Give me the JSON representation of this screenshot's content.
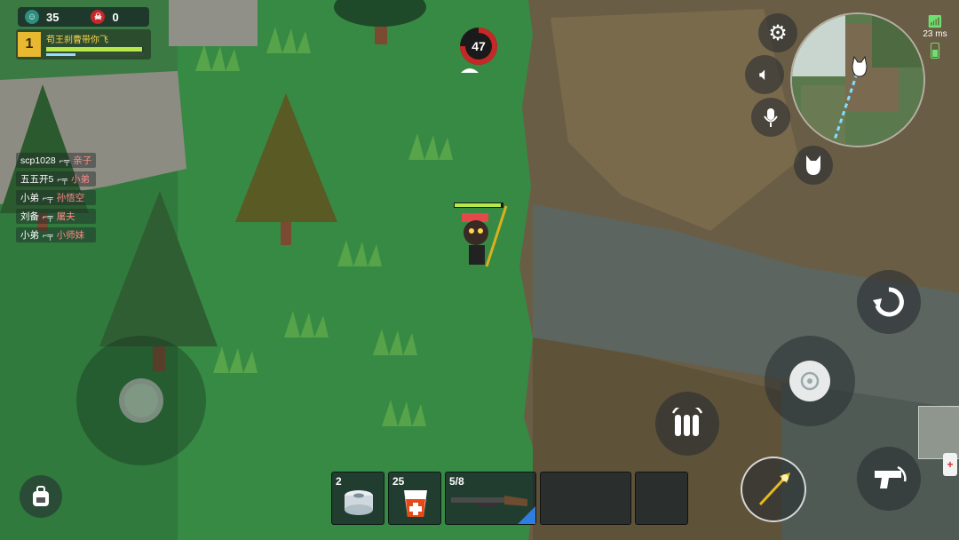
{
  "hud": {
    "alive_count": "35",
    "kill_count": "0",
    "team_rank": "1",
    "team_name": "苟王刹曹带你飞",
    "team_hp": 0.98,
    "team_armor": 0.3,
    "zone_timer": "47",
    "ping": "23 ms"
  },
  "killfeed": [
    {
      "killer": "scp1028",
      "victim": "亲子"
    },
    {
      "killer": "五五开5",
      "victim": "小弟"
    },
    {
      "killer": "小弟",
      "victim": "孙悟空"
    },
    {
      "killer": "刘备",
      "victim": "屠夫"
    },
    {
      "killer": "小弟",
      "victim": "小师妹"
    }
  ],
  "hotbar": [
    {
      "count": "2",
      "item": "bandage-icon"
    },
    {
      "count": "25",
      "item": "medkit-drink-icon"
    },
    {
      "count": "5/8",
      "item": "shotgun-icon"
    },
    {
      "count": "",
      "item": "empty-slot"
    },
    {
      "count": "",
      "item": "empty-slot"
    }
  ],
  "colors": {
    "grass": "#2f7a3c",
    "rock": "#6b6350",
    "hp": "#b8e84a",
    "zone_red": "#c62828"
  }
}
